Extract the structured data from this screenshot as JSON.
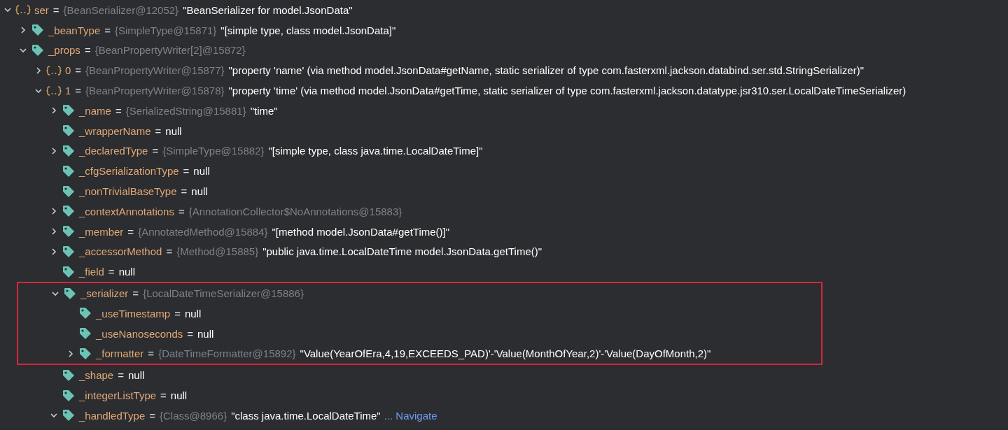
{
  "tree": [
    {
      "kind": "object",
      "name": "ser",
      "eq": "=",
      "type": "{BeanSerializer@12052}",
      "value": "\"BeanSerializer for model.JsonData\"",
      "expanded": true,
      "children": [
        {
          "kind": "field",
          "name": "_beanType",
          "eq": "=",
          "type": "{SimpleType@15871}",
          "value": "\"[simple type, class model.JsonData]\"",
          "expanded": false
        },
        {
          "kind": "field",
          "name": "_props",
          "eq": "=",
          "type": "{BeanPropertyWriter[2]@15872}",
          "expanded": true,
          "children": [
            {
              "kind": "object",
              "name": "0",
              "eq": "=",
              "type": "{BeanPropertyWriter@15877}",
              "value": "\"property 'name' (via method model.JsonData#getName, static serializer of type com.fasterxml.jackson.databind.ser.std.StringSerializer)\"",
              "expanded": false
            },
            {
              "kind": "object",
              "name": "1",
              "eq": "=",
              "type": "{BeanPropertyWriter@15878}",
              "value": "\"property 'time' (via method model.JsonData#getTime, static serializer of type com.fasterxml.jackson.datatype.jsr310.ser.LocalDateTimeSerializer)",
              "expanded": true,
              "children": [
                {
                  "kind": "field",
                  "name": "_name",
                  "eq": "=",
                  "type": "{SerializedString@15881}",
                  "value": "\"time\"",
                  "expanded": false
                },
                {
                  "kind": "field",
                  "name": "_wrapperName",
                  "eq": "=",
                  "value": "null"
                },
                {
                  "kind": "field",
                  "name": "_declaredType",
                  "eq": "=",
                  "type": "{SimpleType@15882}",
                  "value": "\"[simple type, class java.time.LocalDateTime]\"",
                  "expanded": false
                },
                {
                  "kind": "field",
                  "name": "_cfgSerializationType",
                  "eq": "=",
                  "value": "null"
                },
                {
                  "kind": "field",
                  "name": "_nonTrivialBaseType",
                  "eq": "=",
                  "value": "null"
                },
                {
                  "kind": "field",
                  "name": "_contextAnnotations",
                  "eq": "=",
                  "type": "{AnnotationCollector$NoAnnotations@15883}",
                  "expanded": false
                },
                {
                  "kind": "field",
                  "name": "_member",
                  "eq": "=",
                  "type": "{AnnotatedMethod@15884}",
                  "value": "\"[method model.JsonData#getTime()]\"",
                  "expanded": false
                },
                {
                  "kind": "field",
                  "name": "_accessorMethod",
                  "eq": "=",
                  "type": "{Method@15885}",
                  "value": "\"public java.time.LocalDateTime model.JsonData.getTime()\"",
                  "expanded": false
                },
                {
                  "kind": "field",
                  "name": "_field",
                  "eq": "=",
                  "value": "null"
                },
                {
                  "kind": "field",
                  "name": "_serializer",
                  "eq": "=",
                  "type": "{LocalDateTimeSerializer@15886}",
                  "expanded": true,
                  "highlighted": true,
                  "children": [
                    {
                      "kind": "field",
                      "name": "_useTimestamp",
                      "eq": "=",
                      "value": "null"
                    },
                    {
                      "kind": "field",
                      "name": "_useNanoseconds",
                      "eq": "=",
                      "value": "null"
                    },
                    {
                      "kind": "field",
                      "name": "_formatter",
                      "eq": "=",
                      "type": "{DateTimeFormatter@15892}",
                      "value": "\"Value(YearOfEra,4,19,EXCEEDS_PAD)'-'Value(MonthOfYear,2)'-'Value(DayOfMonth,2)\"",
                      "expanded": false
                    }
                  ]
                },
                {
                  "kind": "field",
                  "name": "_shape",
                  "eq": "=",
                  "value": "null"
                },
                {
                  "kind": "field",
                  "name": "_integerListType",
                  "eq": "=",
                  "value": "null"
                },
                {
                  "kind": "field",
                  "name": "_handledType",
                  "eq": "=",
                  "type": "{Class@8966}",
                  "value": "\"class java.time.LocalDateTime\"",
                  "link": "... Navigate",
                  "expanded": true
                }
              ]
            }
          ]
        }
      ]
    }
  ]
}
